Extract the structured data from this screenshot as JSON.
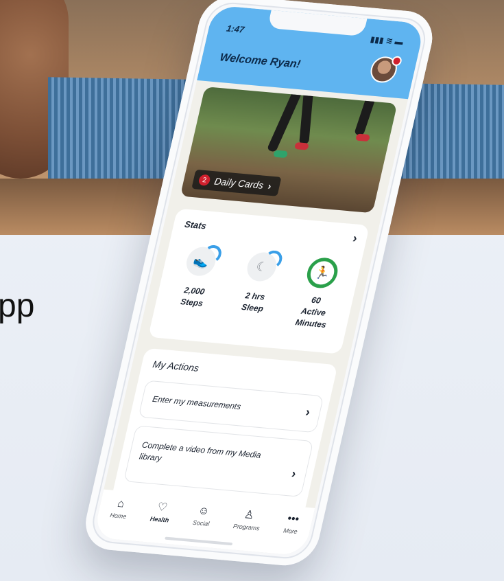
{
  "background": {
    "cropped_text": "pp"
  },
  "phone": {
    "status": {
      "time": "1:47",
      "icons": "▮▮▮ ≋ ▬"
    },
    "header": {
      "welcome": "Welcome Ryan!"
    },
    "hero": {
      "badge_count": "2",
      "label": "Daily Cards",
      "chevron": "›"
    },
    "stats": {
      "title": "Stats",
      "chevron": "›",
      "items": [
        {
          "value": "2,000",
          "label": "Steps",
          "icon": "shoe-icon"
        },
        {
          "value": "2 hrs",
          "label": "Sleep",
          "icon": "moon-icon"
        },
        {
          "value": "60",
          "label": "Active Minutes",
          "icon": "runner-icon"
        }
      ]
    },
    "actions": {
      "title": "My Actions",
      "items": [
        {
          "label": "Enter my measurements",
          "chevron": "›"
        },
        {
          "label": "Complete a video from my Media library",
          "chevron": "›"
        }
      ]
    },
    "tabbar": [
      {
        "label": "Home",
        "icon": "⌂"
      },
      {
        "label": "Health",
        "icon": "♡"
      },
      {
        "label": "Social",
        "icon": "☺"
      },
      {
        "label": "Programs",
        "icon": "♙"
      },
      {
        "label": "More",
        "icon": "•••"
      }
    ],
    "colors": {
      "header": "#5fb4f0",
      "accent_ring": "#2aa04a",
      "progress_arc": "#3a9fe8",
      "badge": "#d0202d"
    }
  }
}
